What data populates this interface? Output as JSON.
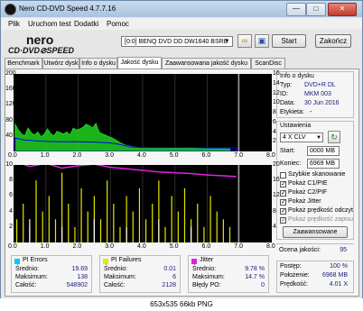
{
  "window": {
    "title": "Nero CD-DVD Speed 4.7.7.16"
  },
  "menu": [
    "Plik",
    "Uruchom test",
    "Dodatki",
    "Pomoc"
  ],
  "toolbar": {
    "logo_top": "nero",
    "logo_bottom": "CD·DVD⊘SPEED",
    "drive": "[0:0]   BENQ DVD DD DW1640 BSRB",
    "start_label": "Start",
    "close_label": "Zakończ"
  },
  "tabs": [
    "Benchmark",
    "Utwórz dysk",
    "Info o dysku",
    "Jakość dysku",
    "Zaawansowana jakość dysku",
    "ScanDisc"
  ],
  "active_tab": "Jakość dysku",
  "chart_data": [
    {
      "type": "area",
      "name": "top",
      "x_ticks": [
        "0.0",
        "1.0",
        "2.0",
        "3.0",
        "4.0",
        "5.0",
        "6.0",
        "7.0",
        "8.0"
      ],
      "xlim": [
        0,
        8
      ],
      "y_left_ticks": [
        "200",
        "160",
        "120",
        "80",
        "40"
      ],
      "ylim_left": [
        0,
        200
      ],
      "y_right_ticks": [
        "16",
        "14",
        "12",
        "10",
        "8",
        "6",
        "4",
        "2"
      ],
      "ylim_right": [
        0,
        16
      ],
      "series": [
        {
          "color": "#1ed41e",
          "x": [
            0.05,
            0.15,
            0.25,
            0.35,
            0.45,
            0.55,
            0.65,
            0.75,
            0.85,
            0.95,
            1.05,
            1.15,
            1.25,
            1.35,
            1.45,
            1.55,
            1.65,
            1.75,
            1.85,
            1.95,
            2.05,
            2.15,
            2.25,
            2.35,
            2.45,
            2.55,
            2.65,
            2.75,
            2.85,
            2.95,
            3.05,
            3.15,
            3.25,
            3.35,
            3.5,
            3.7,
            3.9,
            4.1,
            4.3,
            4.5,
            4.7,
            4.9,
            5.1,
            5.3,
            5.5,
            5.7,
            5.9,
            6.1,
            6.3,
            6.5,
            6.7
          ],
          "y": [
            70,
            55,
            45,
            40,
            60,
            48,
            42,
            50,
            38,
            44,
            58,
            46,
            40,
            52,
            48,
            45,
            50,
            42,
            60,
            55,
            58,
            62,
            70,
            66,
            60,
            72,
            50,
            45,
            42,
            38,
            35,
            30,
            25,
            20,
            15,
            12,
            10,
            10,
            9,
            9,
            9,
            8,
            8,
            8,
            8,
            8,
            8,
            8,
            8,
            8,
            8
          ]
        },
        {
          "color": "#0000ff",
          "x": [
            0.05,
            0.3,
            0.6,
            1.0,
            1.5,
            2.0,
            2.5,
            3.0,
            3.3,
            3.6,
            4.0,
            4.5,
            5.0,
            5.5,
            6.0,
            6.5,
            6.9
          ],
          "y": [
            35,
            30,
            28,
            26,
            25,
            25,
            24,
            22,
            18,
            12,
            10,
            10,
            10,
            10,
            9,
            9,
            9
          ]
        }
      ]
    },
    {
      "type": "bar",
      "name": "bottom",
      "x_ticks": [
        "0.0",
        "1.0",
        "2.0",
        "3.0",
        "4.0",
        "5.0",
        "6.0",
        "7.0",
        "8.0"
      ],
      "xlim": [
        0,
        8
      ],
      "y_left_ticks": [
        "10",
        "8",
        "6",
        "4",
        "2"
      ],
      "ylim_left": [
        0,
        10
      ],
      "y_right_ticks": [
        "20",
        "16",
        "12",
        "8",
        "4"
      ],
      "ylim_right": [
        0,
        20
      ],
      "series": [
        {
          "color": "#e6e600",
          "x": [
            0.1,
            0.3,
            0.5,
            0.7,
            0.9,
            1.1,
            1.3,
            1.5,
            1.7,
            1.9,
            2.1,
            2.3,
            2.5,
            2.7,
            2.9,
            3.1,
            3.3,
            3.5,
            3.7,
            3.9,
            4.1,
            4.3,
            4.5,
            4.7,
            4.9,
            5.1,
            5.3,
            5.5,
            5.7,
            5.9,
            6.1,
            6.3,
            6.5,
            6.7
          ],
          "y": [
            3,
            5,
            2,
            8,
            4,
            6,
            3,
            9,
            5,
            2,
            7,
            4,
            6,
            3,
            8,
            5,
            2,
            6,
            4,
            7,
            3,
            5,
            8,
            2,
            6,
            4,
            7,
            3,
            5,
            2,
            6,
            4,
            3,
            2
          ]
        },
        {
          "color": "#ffffff",
          "x": [
            0.5,
            1.5,
            2.5,
            3.5,
            4.5,
            5.5
          ],
          "y": [
            3,
            2,
            3,
            2,
            3,
            2
          ]
        },
        {
          "color": "#e020e0",
          "line": true,
          "x": [
            0.0,
            0.5,
            1.0,
            1.5,
            2.0,
            2.5,
            3.0,
            3.5,
            4.0,
            4.5,
            5.0,
            5.5,
            6.0,
            6.5,
            6.9
          ],
          "y": [
            10.5,
            9.8,
            10.2,
            9.6,
            9.9,
            10.1,
            9.7,
            9.5,
            9.3,
            9.1,
            9.0,
            8.9,
            8.7,
            8.6,
            8.5
          ]
        }
      ]
    }
  ],
  "info": {
    "section": "Info o dysku",
    "rows": [
      {
        "label": "Typ:",
        "value": "DVD+R DL"
      },
      {
        "label": "ID:",
        "value": "MKM 003"
      },
      {
        "label": "Data:",
        "value": "30 Jun 2016"
      },
      {
        "label": "Etykieta:",
        "value": "-"
      }
    ]
  },
  "settings": {
    "section": "Ustawienia",
    "speed": "4 X CLV",
    "start_label": "Start:",
    "start_value": "0000 MB",
    "end_label": "Koniec:",
    "end_value": "6969 MB",
    "checks": [
      {
        "label": "Szybkie skanowanie",
        "checked": false,
        "disabled": false
      },
      {
        "label": "Pokaż C1/PIE",
        "checked": true,
        "disabled": false
      },
      {
        "label": "Pokaż C2/PIF",
        "checked": true,
        "disabled": false
      },
      {
        "label": "Pokaż Jitter",
        "checked": true,
        "disabled": false
      },
      {
        "label": "Pokaż prędkość odczyt",
        "checked": true,
        "disabled": false
      },
      {
        "label": "Pokaż prędkość zapisu",
        "checked": true,
        "disabled": true
      }
    ],
    "advanced_label": "Zaawansowane"
  },
  "quality": {
    "label": "Ocena jakości:",
    "value": "95"
  },
  "progress": {
    "rows": [
      {
        "label": "Postęp:",
        "value": "100 %"
      },
      {
        "label": "Położenie:",
        "value": "6968 MB"
      },
      {
        "label": "Prędkość:",
        "value": "4.01 X"
      }
    ]
  },
  "stats": [
    {
      "title": "PI Errors",
      "color": "#00c8ff",
      "rows": [
        {
          "label": "Średnio:",
          "value": "19.69"
        },
        {
          "label": "Maksimum:",
          "value": "138"
        },
        {
          "label": "Całość:",
          "value": "548902"
        }
      ]
    },
    {
      "title": "PI Failures",
      "color": "#e6e600",
      "rows": [
        {
          "label": "Średnio:",
          "value": "0.01"
        },
        {
          "label": "Maksimum:",
          "value": "6"
        },
        {
          "label": "Całość:",
          "value": "2128"
        }
      ]
    },
    {
      "title": "Jitter",
      "color": "#e020e0",
      "rows": [
        {
          "label": "Średnio:",
          "value": "9.78 %"
        },
        {
          "label": "Maksimum:",
          "value": "14.7 %"
        },
        {
          "label": "Błędy PO:",
          "value": "0"
        }
      ]
    }
  ],
  "caption": "653x535  66kb  PNG"
}
